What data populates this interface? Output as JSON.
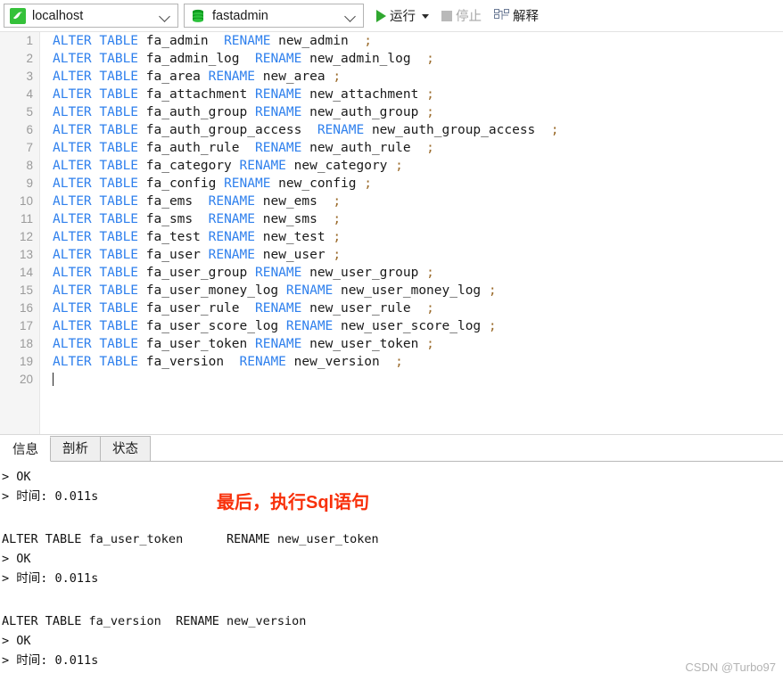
{
  "toolbar": {
    "connection": {
      "icon": "mysql-dolphin-icon",
      "value": "localhost"
    },
    "database": {
      "icon": "database-cylinder-icon",
      "value": "fastadmin"
    },
    "run_label": "运行",
    "stop_label": "停止",
    "explain_label": "解释",
    "run_icon": "play-triangle-icon",
    "run_dropdown_icon": "caret-down-icon",
    "stop_icon": "stop-square-icon",
    "explain_icon": "explain-tree-icon"
  },
  "editor": {
    "total_lines": 20,
    "cursor_line": 20,
    "lines": [
      {
        "n": "1",
        "kw1": "ALTER",
        "kw2": "TABLE",
        "table": " fa_admin  ",
        "kw3": "RENAME",
        "newname": " new_admin  ",
        "semi": ";"
      },
      {
        "n": "2",
        "kw1": "ALTER",
        "kw2": "TABLE",
        "table": " fa_admin_log  ",
        "kw3": "RENAME",
        "newname": " new_admin_log  ",
        "semi": ";"
      },
      {
        "n": "3",
        "kw1": "ALTER",
        "kw2": "TABLE",
        "table": " fa_area ",
        "kw3": "RENAME",
        "newname": " new_area ",
        "semi": ";"
      },
      {
        "n": "4",
        "kw1": "ALTER",
        "kw2": "TABLE",
        "table": " fa_attachment ",
        "kw3": "RENAME",
        "newname": " new_attachment ",
        "semi": ";"
      },
      {
        "n": "5",
        "kw1": "ALTER",
        "kw2": "TABLE",
        "table": " fa_auth_group ",
        "kw3": "RENAME",
        "newname": " new_auth_group ",
        "semi": ";"
      },
      {
        "n": "6",
        "kw1": "ALTER",
        "kw2": "TABLE",
        "table": " fa_auth_group_access  ",
        "kw3": "RENAME",
        "newname": " new_auth_group_access  ",
        "semi": ";"
      },
      {
        "n": "7",
        "kw1": "ALTER",
        "kw2": "TABLE",
        "table": " fa_auth_rule  ",
        "kw3": "RENAME",
        "newname": " new_auth_rule  ",
        "semi": ";"
      },
      {
        "n": "8",
        "kw1": "ALTER",
        "kw2": "TABLE",
        "table": " fa_category ",
        "kw3": "RENAME",
        "newname": " new_category ",
        "semi": ";"
      },
      {
        "n": "9",
        "kw1": "ALTER",
        "kw2": "TABLE",
        "table": " fa_config ",
        "kw3": "RENAME",
        "newname": " new_config ",
        "semi": ";"
      },
      {
        "n": "10",
        "kw1": "ALTER",
        "kw2": "TABLE",
        "table": " fa_ems  ",
        "kw3": "RENAME",
        "newname": " new_ems  ",
        "semi": ";"
      },
      {
        "n": "11",
        "kw1": "ALTER",
        "kw2": "TABLE",
        "table": " fa_sms  ",
        "kw3": "RENAME",
        "newname": " new_sms  ",
        "semi": ";"
      },
      {
        "n": "12",
        "kw1": "ALTER",
        "kw2": "TABLE",
        "table": " fa_test ",
        "kw3": "RENAME",
        "newname": " new_test ",
        "semi": ";"
      },
      {
        "n": "13",
        "kw1": "ALTER",
        "kw2": "TABLE",
        "table": " fa_user ",
        "kw3": "RENAME",
        "newname": " new_user ",
        "semi": ";"
      },
      {
        "n": "14",
        "kw1": "ALTER",
        "kw2": "TABLE",
        "table": " fa_user_group ",
        "kw3": "RENAME",
        "newname": " new_user_group ",
        "semi": ";"
      },
      {
        "n": "15",
        "kw1": "ALTER",
        "kw2": "TABLE",
        "table": " fa_user_money_log ",
        "kw3": "RENAME",
        "newname": " new_user_money_log ",
        "semi": ";"
      },
      {
        "n": "16",
        "kw1": "ALTER",
        "kw2": "TABLE",
        "table": " fa_user_rule  ",
        "kw3": "RENAME",
        "newname": " new_user_rule  ",
        "semi": ";"
      },
      {
        "n": "17",
        "kw1": "ALTER",
        "kw2": "TABLE",
        "table": " fa_user_score_log ",
        "kw3": "RENAME",
        "newname": " new_user_score_log ",
        "semi": ";"
      },
      {
        "n": "18",
        "kw1": "ALTER",
        "kw2": "TABLE",
        "table": " fa_user_token ",
        "kw3": "RENAME",
        "newname": " new_user_token ",
        "semi": ";"
      },
      {
        "n": "19",
        "kw1": "ALTER",
        "kw2": "TABLE",
        "table": " fa_version  ",
        "kw3": "RENAME",
        "newname": " new_version  ",
        "semi": ";"
      },
      {
        "n": "20",
        "kw1": "",
        "kw2": "",
        "table": "",
        "kw3": "",
        "newname": "",
        "semi": ""
      }
    ]
  },
  "result": {
    "tabs": [
      {
        "label": "信息",
        "active": true
      },
      {
        "label": "剖析",
        "active": false
      },
      {
        "label": "状态",
        "active": false
      }
    ],
    "blocks": [
      {
        "sql": "",
        "ok": "> OK",
        "time": "> 时间: 0.011s"
      },
      {
        "sql": "ALTER TABLE fa_user_token      RENAME new_user_token",
        "ok": "> OK",
        "time": "> 时间: 0.011s"
      },
      {
        "sql": "ALTER TABLE fa_version  RENAME new_version",
        "ok": "> OK",
        "time": "> 时间: 0.011s"
      }
    ]
  },
  "annotation": "最后，执行Sql语句",
  "watermark": "CSDN @Turbo97",
  "colors": {
    "keyword": "#2f80ed",
    "annotation": "#f8300a",
    "run_green": "#2fa72f",
    "gutter_bg": "#f5f5f5"
  }
}
